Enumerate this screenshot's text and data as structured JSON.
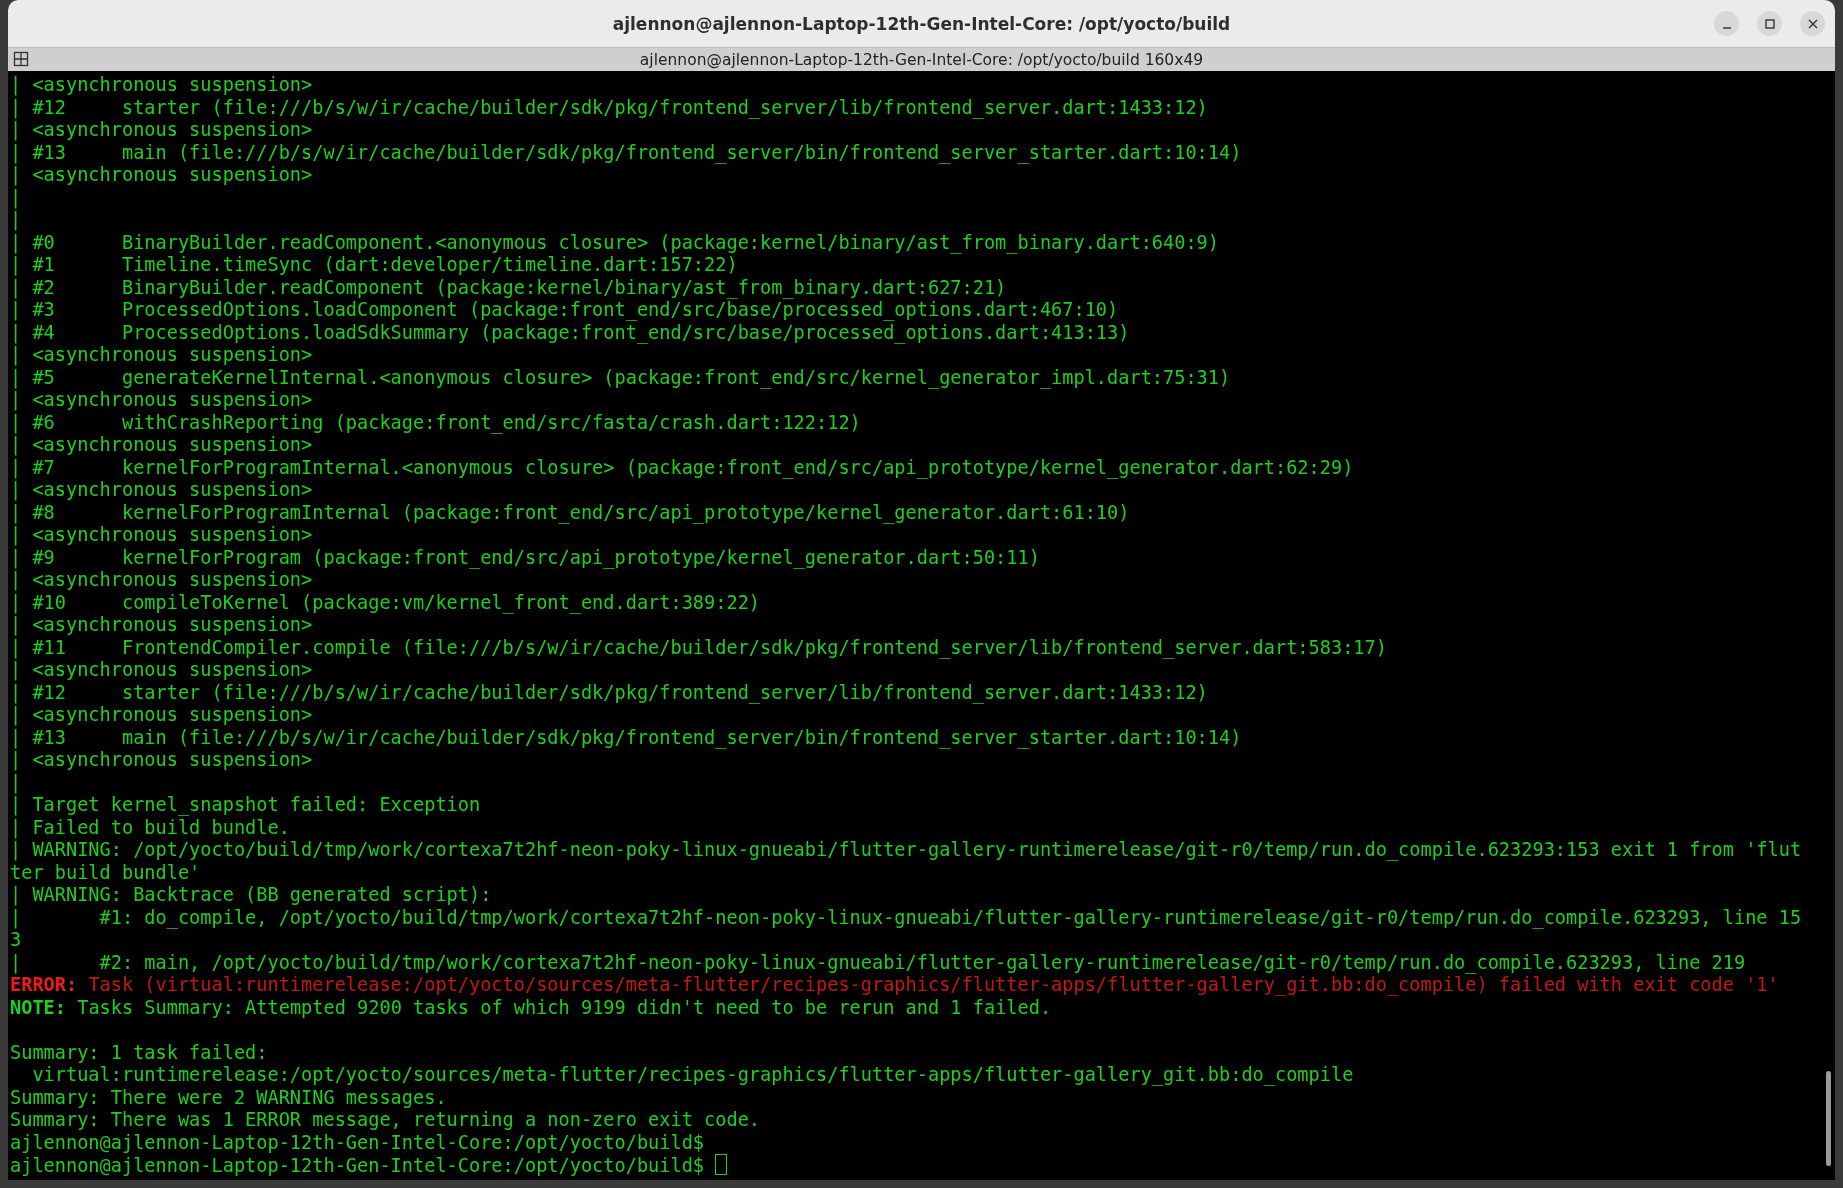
{
  "window": {
    "title": "ajlennon@ajlennon-Laptop-12th-Gen-Intel-Core: /opt/yocto/build"
  },
  "tab_bar": {
    "title": "ajlennon@ajlennon-Laptop-12th-Gen-Intel-Core: /opt/yocto/build 160x49"
  },
  "terminal": {
    "lines": [
      {
        "kind": "text",
        "text": "| <asynchronous suspension>"
      },
      {
        "kind": "text",
        "text": "| #12     starter (file:///b/s/w/ir/cache/builder/sdk/pkg/frontend_server/lib/frontend_server.dart:1433:12)"
      },
      {
        "kind": "text",
        "text": "| <asynchronous suspension>"
      },
      {
        "kind": "text",
        "text": "| #13     main (file:///b/s/w/ir/cache/builder/sdk/pkg/frontend_server/bin/frontend_server_starter.dart:10:14)"
      },
      {
        "kind": "text",
        "text": "| <asynchronous suspension>"
      },
      {
        "kind": "text",
        "text": "|"
      },
      {
        "kind": "text",
        "text": "|"
      },
      {
        "kind": "text",
        "text": "| #0      BinaryBuilder.readComponent.<anonymous closure> (package:kernel/binary/ast_from_binary.dart:640:9)"
      },
      {
        "kind": "text",
        "text": "| #1      Timeline.timeSync (dart:developer/timeline.dart:157:22)"
      },
      {
        "kind": "text",
        "text": "| #2      BinaryBuilder.readComponent (package:kernel/binary/ast_from_binary.dart:627:21)"
      },
      {
        "kind": "text",
        "text": "| #3      ProcessedOptions.loadComponent (package:front_end/src/base/processed_options.dart:467:10)"
      },
      {
        "kind": "text",
        "text": "| #4      ProcessedOptions.loadSdkSummary (package:front_end/src/base/processed_options.dart:413:13)"
      },
      {
        "kind": "text",
        "text": "| <asynchronous suspension>"
      },
      {
        "kind": "text",
        "text": "| #5      generateKernelInternal.<anonymous closure> (package:front_end/src/kernel_generator_impl.dart:75:31)"
      },
      {
        "kind": "text",
        "text": "| <asynchronous suspension>"
      },
      {
        "kind": "text",
        "text": "| #6      withCrashReporting (package:front_end/src/fasta/crash.dart:122:12)"
      },
      {
        "kind": "text",
        "text": "| <asynchronous suspension>"
      },
      {
        "kind": "text",
        "text": "| #7      kernelForProgramInternal.<anonymous closure> (package:front_end/src/api_prototype/kernel_generator.dart:62:29)"
      },
      {
        "kind": "text",
        "text": "| <asynchronous suspension>"
      },
      {
        "kind": "text",
        "text": "| #8      kernelForProgramInternal (package:front_end/src/api_prototype/kernel_generator.dart:61:10)"
      },
      {
        "kind": "text",
        "text": "| <asynchronous suspension>"
      },
      {
        "kind": "text",
        "text": "| #9      kernelForProgram (package:front_end/src/api_prototype/kernel_generator.dart:50:11)"
      },
      {
        "kind": "text",
        "text": "| <asynchronous suspension>"
      },
      {
        "kind": "text",
        "text": "| #10     compileToKernel (package:vm/kernel_front_end.dart:389:22)"
      },
      {
        "kind": "text",
        "text": "| <asynchronous suspension>"
      },
      {
        "kind": "text",
        "text": "| #11     FrontendCompiler.compile (file:///b/s/w/ir/cache/builder/sdk/pkg/frontend_server/lib/frontend_server.dart:583:17)"
      },
      {
        "kind": "text",
        "text": "| <asynchronous suspension>"
      },
      {
        "kind": "text",
        "text": "| #12     starter (file:///b/s/w/ir/cache/builder/sdk/pkg/frontend_server/lib/frontend_server.dart:1433:12)"
      },
      {
        "kind": "text",
        "text": "| <asynchronous suspension>"
      },
      {
        "kind": "text",
        "text": "| #13     main (file:///b/s/w/ir/cache/builder/sdk/pkg/frontend_server/bin/frontend_server_starter.dart:10:14)"
      },
      {
        "kind": "text",
        "text": "| <asynchronous suspension>"
      },
      {
        "kind": "text",
        "text": "|"
      },
      {
        "kind": "text",
        "text": "| Target kernel_snapshot failed: Exception"
      },
      {
        "kind": "text",
        "text": "| Failed to build bundle."
      },
      {
        "kind": "text",
        "text": "| WARNING: /opt/yocto/build/tmp/work/cortexa7t2hf-neon-poky-linux-gnueabi/flutter-gallery-runtimerelease/git-r0/temp/run.do_compile.623293:153 exit 1 from 'flut"
      },
      {
        "kind": "text",
        "text": "ter build bundle'"
      },
      {
        "kind": "text",
        "text": "| WARNING: Backtrace (BB generated script):"
      },
      {
        "kind": "text",
        "text": "|       #1: do_compile, /opt/yocto/build/tmp/work/cortexa7t2hf-neon-poky-linux-gnueabi/flutter-gallery-runtimerelease/git-r0/temp/run.do_compile.623293, line 15"
      },
      {
        "kind": "text",
        "text": "3"
      },
      {
        "kind": "text",
        "text": "|       #2: main, /opt/yocto/build/tmp/work/cortexa7t2hf-neon-poky-linux-gnueabi/flutter-gallery-runtimerelease/git-r0/temp/run.do_compile.623293, line 219"
      },
      {
        "kind": "error",
        "label": "ERROR:",
        "text": "Task (virtual:runtimerelease:/opt/yocto/sources/meta-flutter/recipes-graphics/flutter-apps/flutter-gallery_git.bb:do_compile) failed with exit code '1'"
      },
      {
        "kind": "note",
        "label": "NOTE:",
        "text": "Tasks Summary: Attempted 9200 tasks of which 9199 didn't need to be rerun and 1 failed."
      },
      {
        "kind": "blank"
      },
      {
        "kind": "text",
        "text": "Summary: 1 task failed:"
      },
      {
        "kind": "text",
        "text": "  virtual:runtimerelease:/opt/yocto/sources/meta-flutter/recipes-graphics/flutter-apps/flutter-gallery_git.bb:do_compile"
      },
      {
        "kind": "text",
        "text": "Summary: There were 2 WARNING messages."
      },
      {
        "kind": "text",
        "text": "Summary: There was 1 ERROR message, returning a non-zero exit code."
      },
      {
        "kind": "text",
        "text": "ajlennon@ajlennon-Laptop-12th-Gen-Intel-Core:/opt/yocto/build$"
      },
      {
        "kind": "prompt",
        "text": "ajlennon@ajlennon-Laptop-12th-Gen-Intel-Core:/opt/yocto/build$"
      }
    ]
  }
}
